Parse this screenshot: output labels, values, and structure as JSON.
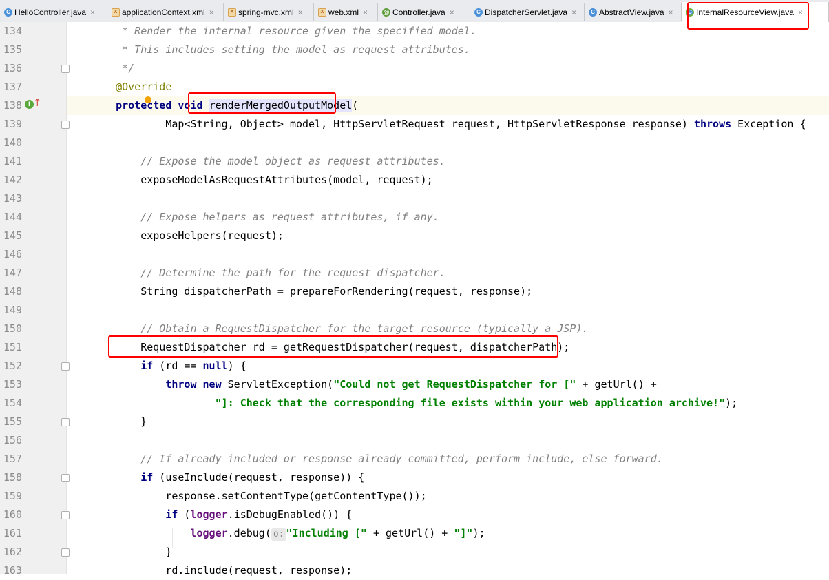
{
  "tabs": [
    {
      "label": "HelloController.java",
      "icon": "class-icon",
      "active": false
    },
    {
      "label": "applicationContext.xml",
      "icon": "xml-file-icon",
      "active": false
    },
    {
      "label": "spring-mvc.xml",
      "icon": "xml-file-icon",
      "active": false
    },
    {
      "label": "web.xml",
      "icon": "xml-file-icon",
      "active": false
    },
    {
      "label": "Controller.java",
      "icon": "annotation-icon",
      "active": false
    },
    {
      "label": "DispatcherServlet.java",
      "icon": "class-icon",
      "active": false
    },
    {
      "label": "AbstractView.java",
      "icon": "class-icon",
      "active": false
    },
    {
      "label": "InternalResourceView.java",
      "icon": "class-icon",
      "active": true
    }
  ],
  "tab_close_glyph": "×",
  "gutter": {
    "implements_badge": "I",
    "override_arrow": "↑"
  },
  "editor": {
    "caret_line": "138",
    "lines": [
      {
        "num": "134",
        "tokens": [
          {
            "t": "    * Render the internal resource given the specified model.",
            "c": "cm"
          }
        ]
      },
      {
        "num": "135",
        "tokens": [
          {
            "t": "    * This includes setting the model as request attributes.",
            "c": "cm"
          }
        ]
      },
      {
        "num": "136",
        "tokens": [
          {
            "t": "    */",
            "c": "cm"
          }
        ]
      },
      {
        "num": "137",
        "tokens": [
          {
            "t": "   @Override",
            "c": "ann"
          }
        ]
      },
      {
        "num": "138",
        "tokens": [
          {
            "t": "   ",
            "c": ""
          },
          {
            "t": "protected",
            "c": "kw"
          },
          {
            "t": " ",
            "c": ""
          },
          {
            "t": "void",
            "c": "kw"
          },
          {
            "t": " ",
            "c": ""
          },
          {
            "t": "renderMergedOutputModel",
            "c": "hl"
          },
          {
            "t": "(",
            "c": ""
          }
        ]
      },
      {
        "num": "139",
        "tokens": [
          {
            "t": "           Map<String, Object> model, HttpServletRequest request, HttpServletResponse response) ",
            "c": ""
          },
          {
            "t": "throws",
            "c": "kw"
          },
          {
            "t": " Exception {",
            "c": ""
          }
        ]
      },
      {
        "num": "140",
        "tokens": []
      },
      {
        "num": "141",
        "tokens": [
          {
            "t": "       // Expose the model object as request attributes.",
            "c": "cm"
          }
        ]
      },
      {
        "num": "142",
        "tokens": [
          {
            "t": "       exposeModelAsRequestAttributes(model, request);",
            "c": ""
          }
        ]
      },
      {
        "num": "143",
        "tokens": []
      },
      {
        "num": "144",
        "tokens": [
          {
            "t": "       // Expose helpers as request attributes, if any.",
            "c": "cm"
          }
        ]
      },
      {
        "num": "145",
        "tokens": [
          {
            "t": "       exposeHelpers(request);",
            "c": ""
          }
        ]
      },
      {
        "num": "146",
        "tokens": []
      },
      {
        "num": "147",
        "tokens": [
          {
            "t": "       // Determine the path for the request dispatcher.",
            "c": "cm"
          }
        ]
      },
      {
        "num": "148",
        "tokens": [
          {
            "t": "       String dispatcherPath = prepareForRendering(request, response);",
            "c": ""
          }
        ]
      },
      {
        "num": "149",
        "tokens": []
      },
      {
        "num": "150",
        "tokens": [
          {
            "t": "       // Obtain a RequestDispatcher for the target resource (typically a JSP).",
            "c": "cm"
          }
        ]
      },
      {
        "num": "151",
        "tokens": [
          {
            "t": "       RequestDispatcher rd = getRequestDispatcher(request, dispatcherPath);",
            "c": ""
          }
        ]
      },
      {
        "num": "152",
        "tokens": [
          {
            "t": "       ",
            "c": ""
          },
          {
            "t": "if",
            "c": "kw"
          },
          {
            "t": " (rd == ",
            "c": ""
          },
          {
            "t": "null",
            "c": "kw"
          },
          {
            "t": ") {",
            "c": ""
          }
        ]
      },
      {
        "num": "153",
        "tokens": [
          {
            "t": "           ",
            "c": ""
          },
          {
            "t": "throw",
            "c": "kw"
          },
          {
            "t": " ",
            "c": ""
          },
          {
            "t": "new",
            "c": "kw"
          },
          {
            "t": " ServletException(",
            "c": ""
          },
          {
            "t": "\"Could not get RequestDispatcher for [\"",
            "c": "str"
          },
          {
            "t": " + getUrl() +",
            "c": ""
          }
        ]
      },
      {
        "num": "154",
        "tokens": [
          {
            "t": "                   ",
            "c": ""
          },
          {
            "t": "\"]: Check that the corresponding file exists within your web application archive!\"",
            "c": "str"
          },
          {
            "t": ");",
            "c": ""
          }
        ]
      },
      {
        "num": "155",
        "tokens": [
          {
            "t": "       }",
            "c": ""
          }
        ]
      },
      {
        "num": "156",
        "tokens": []
      },
      {
        "num": "157",
        "tokens": [
          {
            "t": "       // If already included or response already committed, perform include, else forward.",
            "c": "cm"
          }
        ]
      },
      {
        "num": "158",
        "tokens": [
          {
            "t": "       ",
            "c": ""
          },
          {
            "t": "if",
            "c": "kw"
          },
          {
            "t": " (useInclude(request, response)) {",
            "c": ""
          }
        ]
      },
      {
        "num": "159",
        "tokens": [
          {
            "t": "           response.setContentType(getContentType());",
            "c": ""
          }
        ]
      },
      {
        "num": "160",
        "tokens": [
          {
            "t": "           ",
            "c": ""
          },
          {
            "t": "if",
            "c": "kw"
          },
          {
            "t": " (",
            "c": ""
          },
          {
            "t": "logger",
            "c": "fld"
          },
          {
            "t": ".isDebugEnabled()) {",
            "c": ""
          }
        ]
      },
      {
        "num": "161",
        "tokens": [
          {
            "t": "               ",
            "c": ""
          },
          {
            "t": "logger",
            "c": "fld"
          },
          {
            "t": ".debug(",
            "c": ""
          },
          {
            "t": "o:",
            "c": "hint"
          },
          {
            "t": "\"Including [\"",
            "c": "str"
          },
          {
            "t": " + getUrl() + ",
            "c": ""
          },
          {
            "t": "\"]\"",
            "c": "str"
          },
          {
            "t": ");",
            "c": ""
          }
        ]
      },
      {
        "num": "162",
        "tokens": [
          {
            "t": "           }",
            "c": ""
          }
        ]
      },
      {
        "num": "163",
        "tokens": [
          {
            "t": "           rd.include(request, response);",
            "c": ""
          }
        ]
      }
    ]
  },
  "colors": {
    "highlight_box": "#ff0000",
    "keyword": "#000080",
    "comment": "#808080",
    "string": "#008000",
    "annotation": "#808000",
    "field": "#660e7a"
  }
}
